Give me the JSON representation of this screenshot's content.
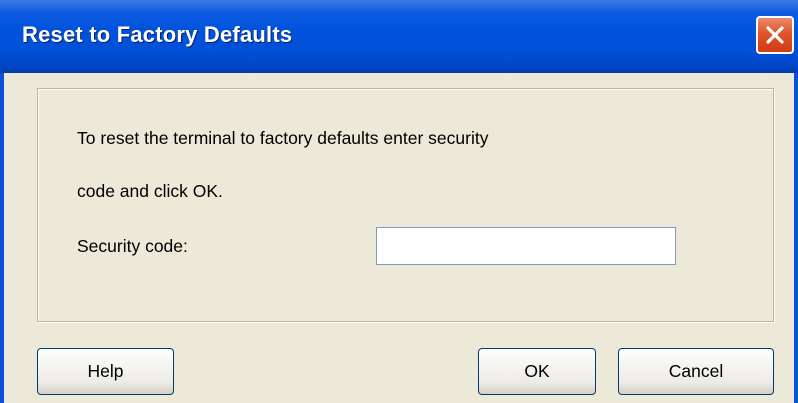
{
  "window": {
    "title": "Reset to Factory Defaults",
    "close_icon": "close-icon"
  },
  "message": {
    "line1": "To reset the terminal to factory defaults enter security",
    "line2": "code and click OK."
  },
  "security_code": {
    "label": "Security code:",
    "value": ""
  },
  "buttons": {
    "help": "Help",
    "ok": "OK",
    "cancel": "Cancel"
  },
  "colors": {
    "titlebar": "#0153dc",
    "close_button": "#e0552c",
    "dialog_background": "#ece9d8"
  }
}
